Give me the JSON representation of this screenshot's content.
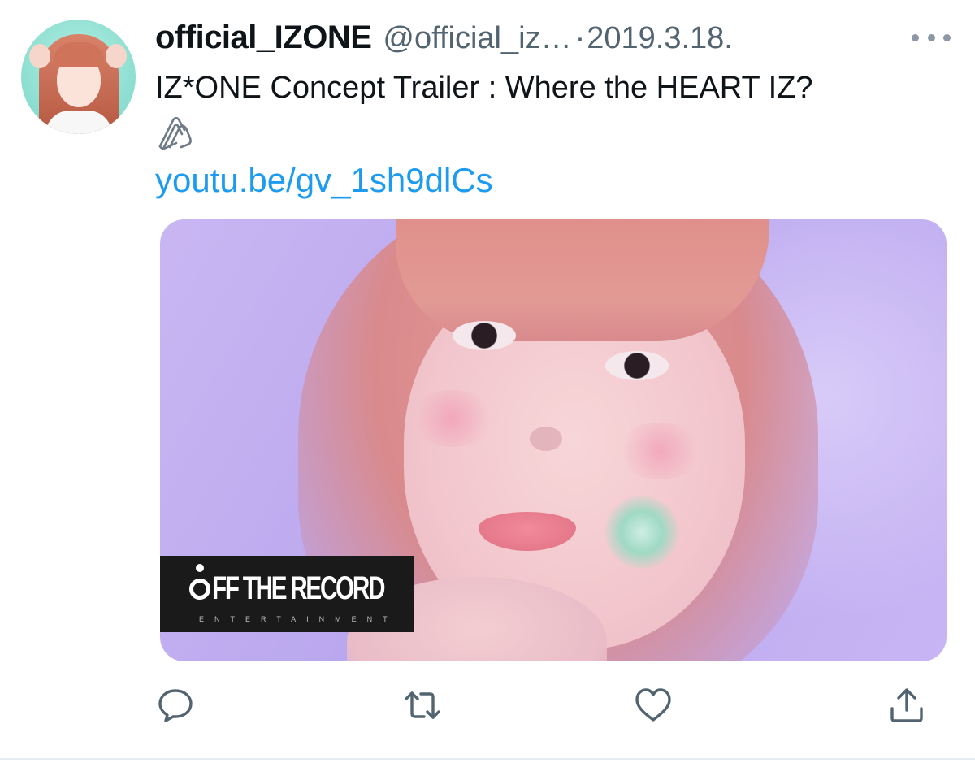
{
  "tweet": {
    "display_name": "official_IZONE",
    "handle": "@official_iz…",
    "separator": "·",
    "date": "2019.3.18.",
    "text": "IZ*ONE Concept Trailer : Where the HEART IZ?",
    "link_text": "youtu.be/gv_1sh9dlCs"
  },
  "media": {
    "logo_main": "FF THE RECORD",
    "logo_sub": "ENTERTAINMENT"
  },
  "icons": {
    "attachment": "paperclip-icon",
    "more": "more-dots-icon",
    "reply": "reply-bubble-icon",
    "retweet": "retweet-icon",
    "like": "heart-icon",
    "share": "share-upload-icon"
  },
  "colors": {
    "link": "#1d9bf0",
    "secondary_text": "#536471",
    "icon_gray": "#536471"
  }
}
